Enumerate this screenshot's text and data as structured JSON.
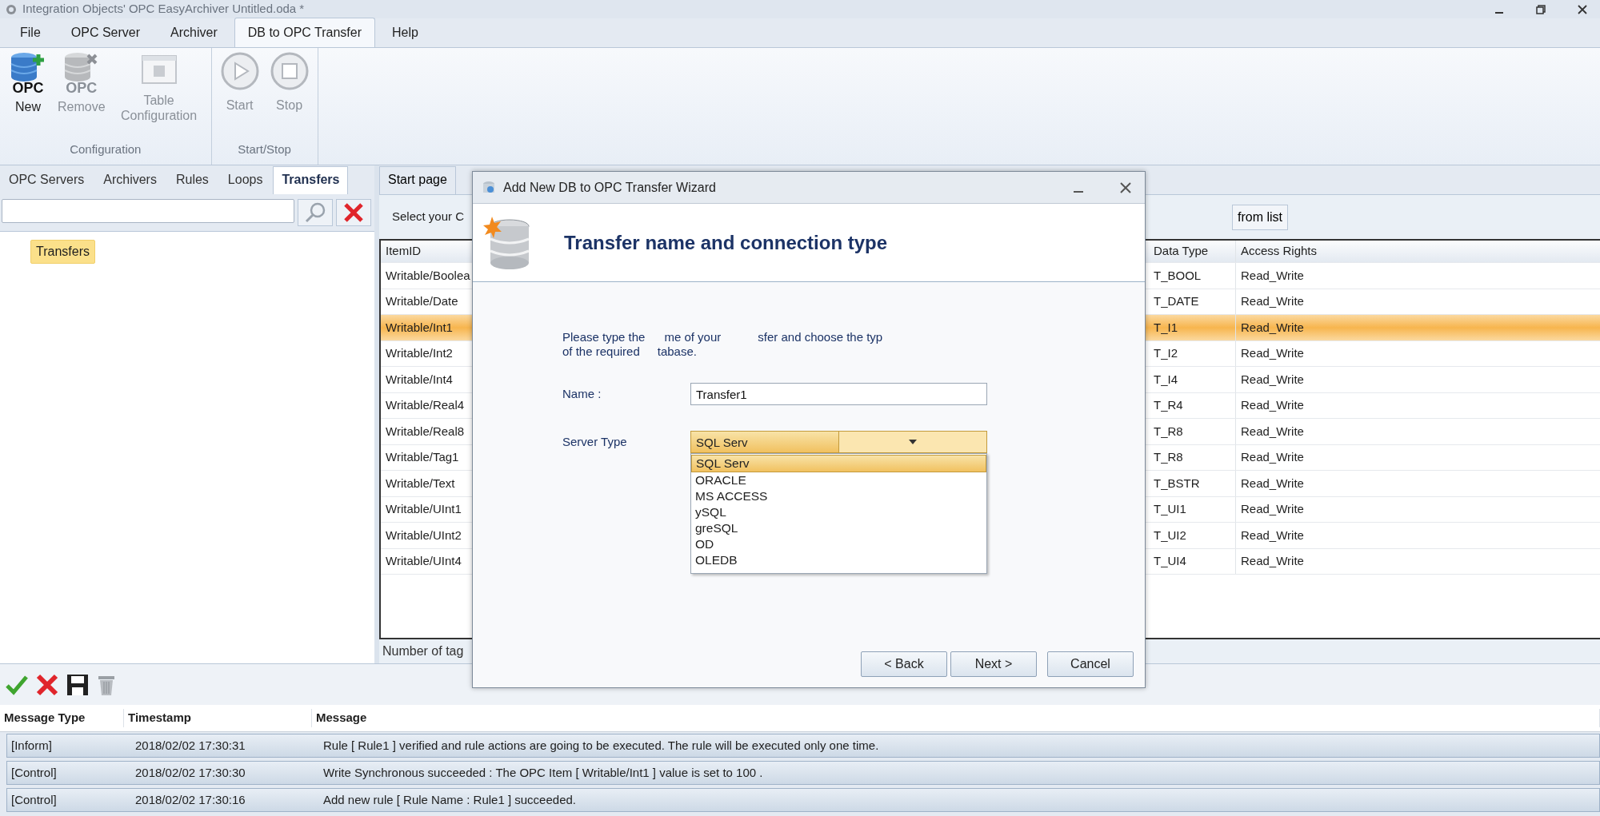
{
  "window": {
    "title": "Integration Objects' OPC EasyArchiver   Untitled.oda *"
  },
  "menu_tabs": [
    {
      "label": "File",
      "selected": false
    },
    {
      "label": "OPC Server",
      "selected": false
    },
    {
      "label": "Archiver",
      "selected": false
    },
    {
      "label": "DB to OPC Transfer",
      "selected": true
    },
    {
      "label": "Help",
      "selected": false
    }
  ],
  "ribbon": {
    "groups": [
      {
        "label": "Configuration",
        "buttons": [
          {
            "kind": "add",
            "label": "New",
            "badge": "OPC",
            "disabled": false
          },
          {
            "kind": "remove",
            "label": "Remove",
            "badge": "OPC",
            "disabled": true
          },
          {
            "kind": "table",
            "label": "Table Configuration",
            "disabled": true
          }
        ]
      },
      {
        "label": "Start/Stop",
        "buttons": [
          {
            "kind": "start",
            "label": "Start",
            "disabled": true
          },
          {
            "kind": "stop",
            "label": "Stop",
            "disabled": true
          }
        ]
      }
    ]
  },
  "left_panel": {
    "tabs": [
      {
        "label": "OPC Servers",
        "selected": false
      },
      {
        "label": "Archivers",
        "selected": false
      },
      {
        "label": "Rules",
        "selected": false
      },
      {
        "label": "Loops",
        "selected": false
      },
      {
        "label": "Transfers",
        "selected": true
      }
    ],
    "tree": [
      {
        "label": "Transfers",
        "selected": true
      }
    ]
  },
  "document_tabs": [
    {
      "label": "Start page",
      "selected": false
    }
  ],
  "toolbar": {
    "prompt": "Select your C",
    "button": "from list"
  },
  "items_table": {
    "columns": [
      "ItemID",
      "Data Type",
      "Access Rights"
    ],
    "rows": [
      {
        "item_id": "Writable/Boolea",
        "data_type": "T_BOOL",
        "access": "Read_Write",
        "selected": false
      },
      {
        "item_id": "Writable/Date",
        "data_type": "T_DATE",
        "access": "Read_Write",
        "selected": false
      },
      {
        "item_id": "Writable/Int1",
        "data_type": "T_I1",
        "access": "Read_Write",
        "selected": true
      },
      {
        "item_id": "Writable/Int2",
        "data_type": "T_I2",
        "access": "Read_Write",
        "selected": false
      },
      {
        "item_id": "Writable/Int4",
        "data_type": "T_I4",
        "access": "Read_Write",
        "selected": false
      },
      {
        "item_id": "Writable/Real4",
        "data_type": "T_R4",
        "access": "Read_Write",
        "selected": false
      },
      {
        "item_id": "Writable/Real8",
        "data_type": "T_R8",
        "access": "Read_Write",
        "selected": false
      },
      {
        "item_id": "Writable/Tag1",
        "data_type": "T_R8",
        "access": "Read_Write",
        "selected": false
      },
      {
        "item_id": "Writable/Text",
        "data_type": "T_BSTR",
        "access": "Read_Write",
        "selected": false
      },
      {
        "item_id": "Writable/UInt1",
        "data_type": "T_UI1",
        "access": "Read_Write",
        "selected": false
      },
      {
        "item_id": "Writable/UInt2",
        "data_type": "T_UI2",
        "access": "Read_Write",
        "selected": false
      },
      {
        "item_id": "Writable/UInt4",
        "data_type": "T_UI4",
        "access": "Read_Write",
        "selected": false
      }
    ],
    "footer": "Number of tag"
  },
  "dialog": {
    "title": "Add New DB to OPC Transfer Wizard",
    "heading": "Transfer name and connection type",
    "instructions": [
      [
        "Please type the",
        "me of your",
        "sfer and choose the typ"
      ],
      [
        "of the required",
        "tabase."
      ]
    ],
    "name_label": "Name :",
    "name_value": "Transfer1",
    "server_type_label": "Server Type",
    "server_type_value": "SQL Serv",
    "server_options": [
      {
        "label": "SQL Serv",
        "selected": true
      },
      {
        "label": "ORACLE",
        "selected": false
      },
      {
        "label": "MS ACCESS",
        "selected": false
      },
      {
        "label": "ySQL",
        "selected": false
      },
      {
        "label": "greSQL",
        "selected": false
      },
      {
        "label": "OD",
        "selected": false
      },
      {
        "label": "OLEDB",
        "selected": false
      }
    ],
    "buttons": [
      "< Back",
      "Next >",
      "Cancel"
    ]
  },
  "log": {
    "columns": [
      "Message Type",
      "Timestamp",
      "Message"
    ],
    "rows": [
      {
        "type": "[Inform]",
        "timestamp": "2018/02/02 17:30:31",
        "message": "Rule [ Rule1 ] verified and rule actions are going to be executed. The rule will be executed only one time."
      },
      {
        "type": "[Control]",
        "timestamp": "2018/02/02 17:30:30",
        "message": "Write Synchronous succeeded : The OPC Item [ Writable/Int1 ] value is set to 100 ."
      },
      {
        "type": "[Control]",
        "timestamp": "2018/02/02 17:30:16",
        "message": "Add new rule [ Rule Name : Rule1 ] succeeded."
      }
    ]
  }
}
